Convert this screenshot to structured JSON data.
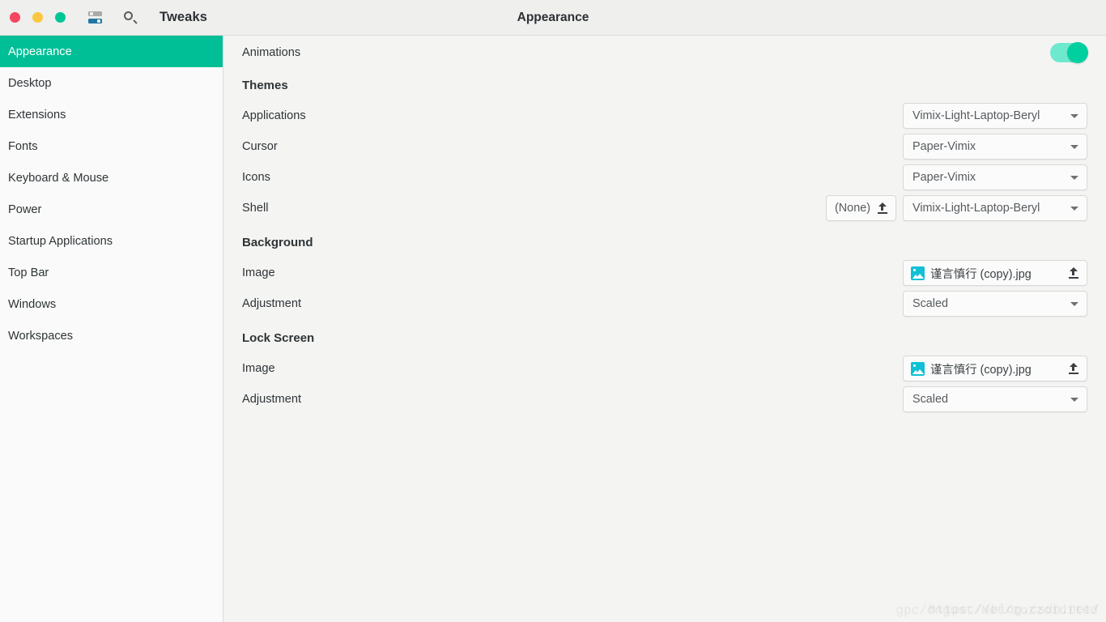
{
  "window": {
    "app_name": "Tweaks",
    "title": "Appearance",
    "controls": {
      "close": "close-button",
      "minimize": "minimize-button",
      "maximize": "maximize-button"
    },
    "icons": {
      "sliders": "sliders-icon",
      "search": "search-icon"
    }
  },
  "sidebar": {
    "items": [
      {
        "label": "Appearance",
        "selected": true
      },
      {
        "label": "Desktop",
        "selected": false
      },
      {
        "label": "Extensions",
        "selected": false
      },
      {
        "label": "Fonts",
        "selected": false
      },
      {
        "label": "Keyboard & Mouse",
        "selected": false
      },
      {
        "label": "Power",
        "selected": false
      },
      {
        "label": "Startup Applications",
        "selected": false
      },
      {
        "label": "Top Bar",
        "selected": false
      },
      {
        "label": "Windows",
        "selected": false
      },
      {
        "label": "Workspaces",
        "selected": false
      }
    ]
  },
  "content": {
    "animations": {
      "label": "Animations",
      "toggle_state": "on"
    },
    "themes": {
      "heading": "Themes",
      "applications": {
        "label": "Applications",
        "value": "Vimix-Light-Laptop-Beryl"
      },
      "cursor": {
        "label": "Cursor",
        "value": "Paper-Vimix"
      },
      "icons": {
        "label": "Icons",
        "value": "Paper-Vimix"
      },
      "shell": {
        "label": "Shell",
        "upload_label": "(None)",
        "value": "Vimix-Light-Laptop-Beryl"
      }
    },
    "background": {
      "heading": "Background",
      "image": {
        "label": "Image",
        "filename": "谨言慎行 (copy).jpg"
      },
      "adjustment": {
        "label": "Adjustment",
        "value": "Scaled"
      }
    },
    "lock_screen": {
      "heading": "Lock Screen",
      "image": {
        "label": "Image",
        "filename": "谨言慎行 (copy).jpg"
      },
      "adjustment": {
        "label": "Adjustment",
        "value": "Scaled"
      }
    }
  },
  "watermark": {
    "line1": "https://blog.csdn.net/",
    "line2": "gpc/dngust/Net/zozzoidited"
  },
  "colors": {
    "accent": "#00bf97",
    "toggle_on": "#00cfa0",
    "close": "#f6465f",
    "minimize": "#fbc740",
    "maximize": "#00c795",
    "image_icon": "#11c0d4"
  }
}
